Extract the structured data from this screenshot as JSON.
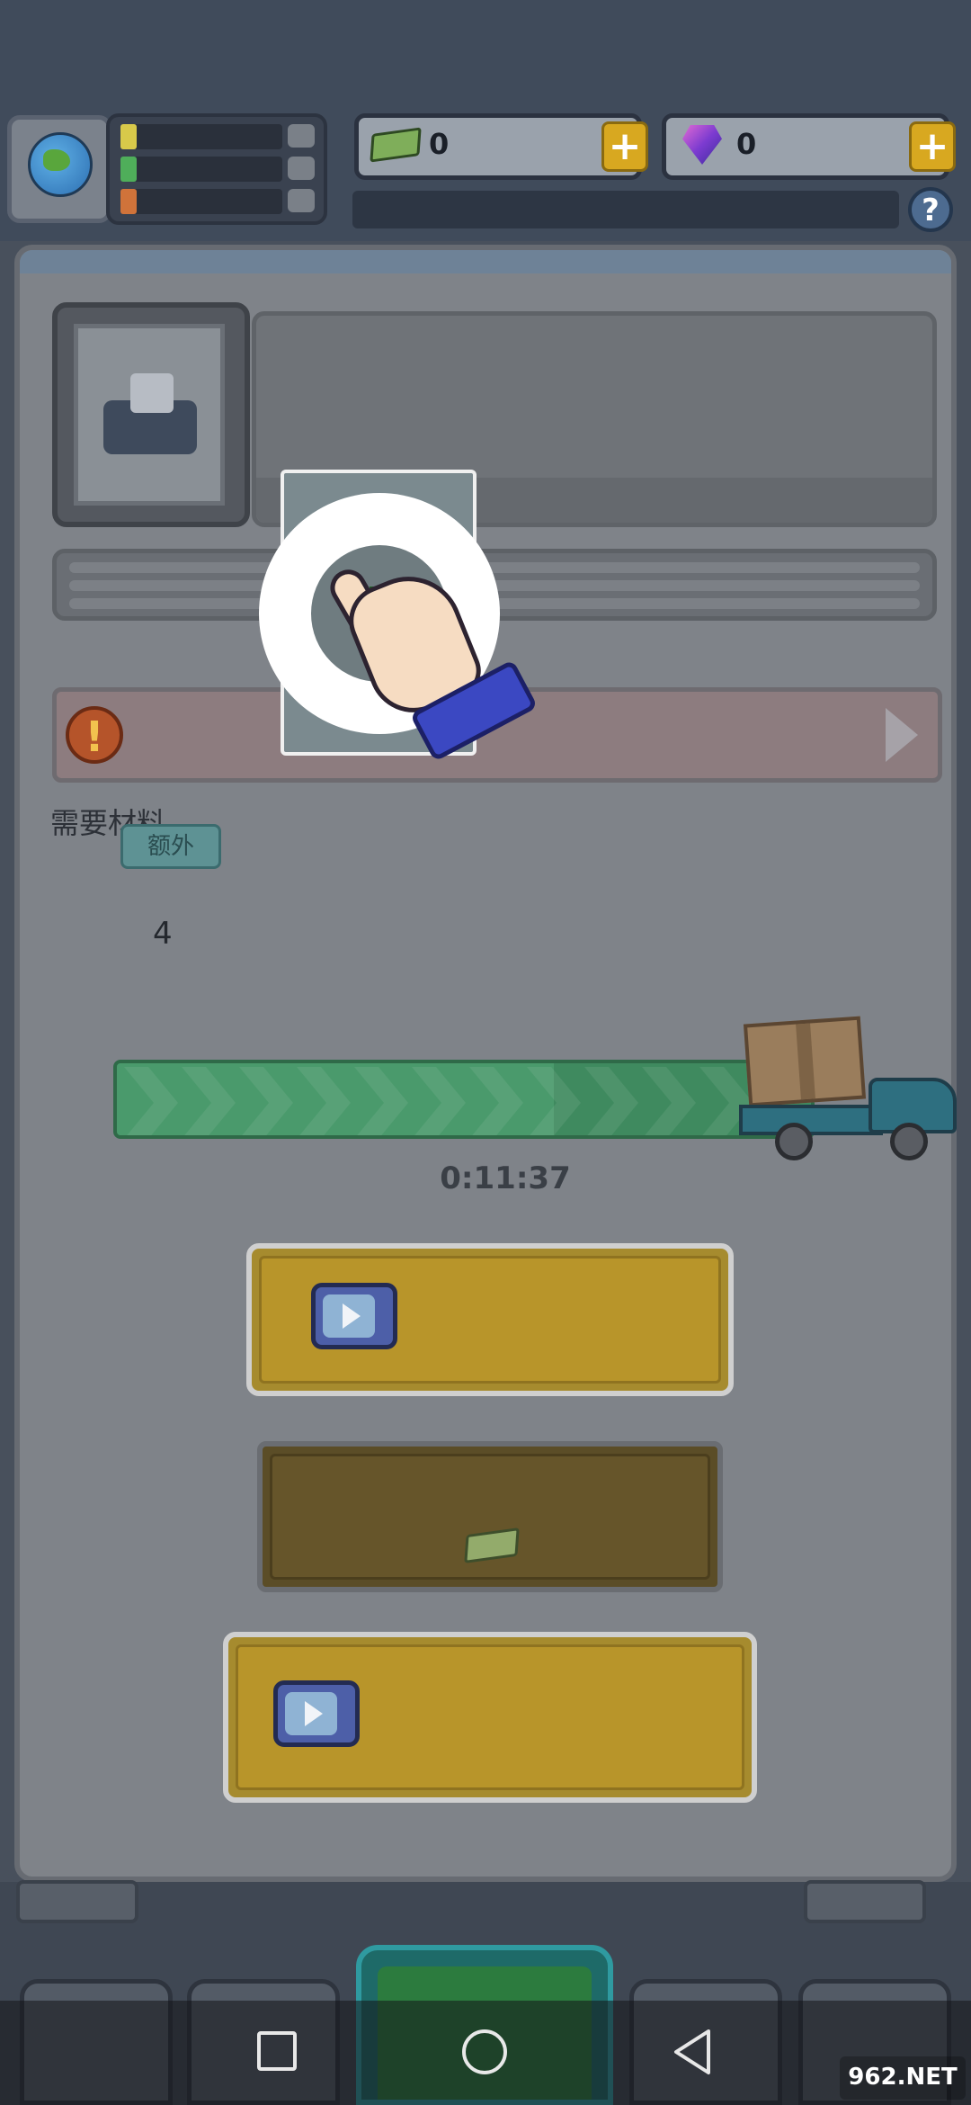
{
  "hud": {
    "cash_value": "0",
    "gem_value": "0",
    "help_label": "?",
    "plus_label": "+",
    "stat_colors": [
      "#d8c94a",
      "#4fae5a",
      "#d0733a"
    ]
  },
  "panel": {
    "warning_mark": "!",
    "materials_label": "需要材料",
    "extra_tag": "额外",
    "material_count": "4",
    "progress_fraction": 0.63,
    "timer": "0:11:37"
  },
  "icons": {
    "globe": "globe-icon",
    "cash": "cash-icon",
    "gem": "gem-icon",
    "tv": "tv-video-icon",
    "truck": "delivery-truck-icon",
    "hand": "tutorial-hand-icon",
    "plus": "green-plus-icon"
  },
  "colors": {
    "accent_yellow": "#d8a820",
    "progress_green": "#3f8a5f",
    "teal_tab": "#2f9aa0"
  },
  "watermark": "962.NET"
}
